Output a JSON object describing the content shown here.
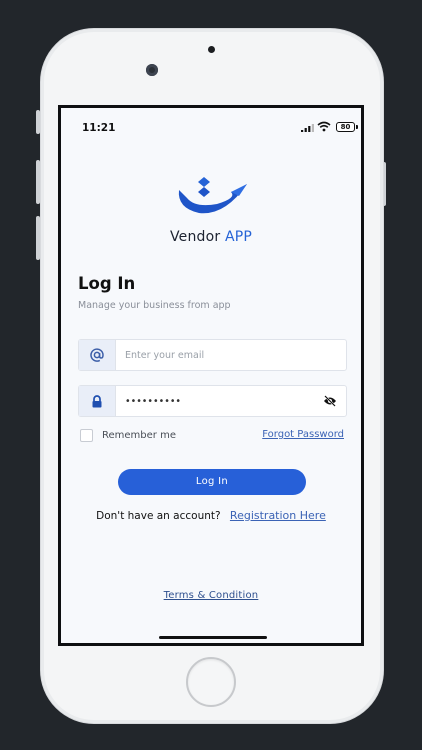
{
  "status_bar": {
    "time": "11:21",
    "battery": "80"
  },
  "brand": {
    "name": "Vendor",
    "accent": "APP"
  },
  "login": {
    "title": "Log In",
    "subtitle": "Manage your business from app",
    "email_placeholder": "Enter your email",
    "password_value": "••••••••••",
    "remember_label": "Remember me",
    "forgot_label": "Forgot Password",
    "submit_label": "Log In"
  },
  "register": {
    "prompt": "Don't have an account?",
    "link": "Registration Here"
  },
  "footer": {
    "terms": "Terms & Condition"
  },
  "colors": {
    "primary": "#2760d8",
    "link": "#3b63b5",
    "addon_bg": "#e9eef8"
  }
}
